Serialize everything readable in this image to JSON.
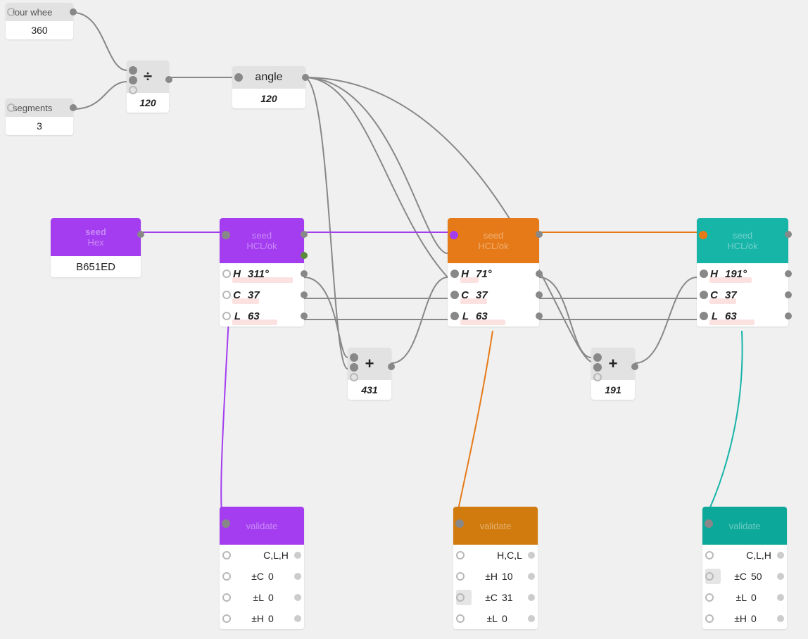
{
  "inputs": {
    "colour_wheel": {
      "label": "lour whee",
      "value": "360"
    },
    "segments": {
      "label": "segments",
      "value": "3"
    }
  },
  "ops": {
    "divide": {
      "symbol": "÷",
      "result": "120"
    },
    "angle": {
      "label": "angle",
      "result": "120"
    },
    "add1": {
      "symbol": "+",
      "result": "431"
    },
    "add2": {
      "symbol": "+",
      "result": "191"
    }
  },
  "seed_hex": {
    "title": "seed",
    "subtitle": "Hex",
    "value": "B651ED",
    "color": "#a43cf0"
  },
  "hcl": [
    {
      "title": "seed",
      "subtitle": "HCL/ok",
      "color": "#a43cf0",
      "rows": [
        [
          "H",
          "311°"
        ],
        [
          "C",
          "37"
        ],
        [
          "L",
          "63"
        ]
      ]
    },
    {
      "title": "seed",
      "subtitle": "HCL/ok",
      "color": "#e67a18",
      "rows": [
        [
          "H",
          "71°"
        ],
        [
          "C",
          "37"
        ],
        [
          "L",
          "63"
        ]
      ]
    },
    {
      "title": "seed",
      "subtitle": "HCL/ok",
      "color": "#17b4a8",
      "rows": [
        [
          "H",
          "191°"
        ],
        [
          "C",
          "37"
        ],
        [
          "L",
          "63"
        ]
      ]
    }
  ],
  "validate": [
    {
      "title": "validate",
      "color": "#a43cf0",
      "rows": [
        [
          "",
          "C,L,H"
        ],
        [
          "±C",
          "0"
        ],
        [
          "±L",
          "0"
        ],
        [
          "±H",
          "0"
        ]
      ],
      "selected": null
    },
    {
      "title": "validate",
      "color": "#d17b0e",
      "rows": [
        [
          "",
          "H,C,L"
        ],
        [
          "±H",
          "10"
        ],
        [
          "±C",
          "31"
        ],
        [
          "±L",
          "0"
        ]
      ],
      "selected": 2
    },
    {
      "title": "validate",
      "color": "#0ca89a",
      "rows": [
        [
          "",
          "C,L,H"
        ],
        [
          "±C",
          "50"
        ],
        [
          "±L",
          "0"
        ],
        [
          "±H",
          "0"
        ]
      ],
      "selected": 1
    }
  ]
}
